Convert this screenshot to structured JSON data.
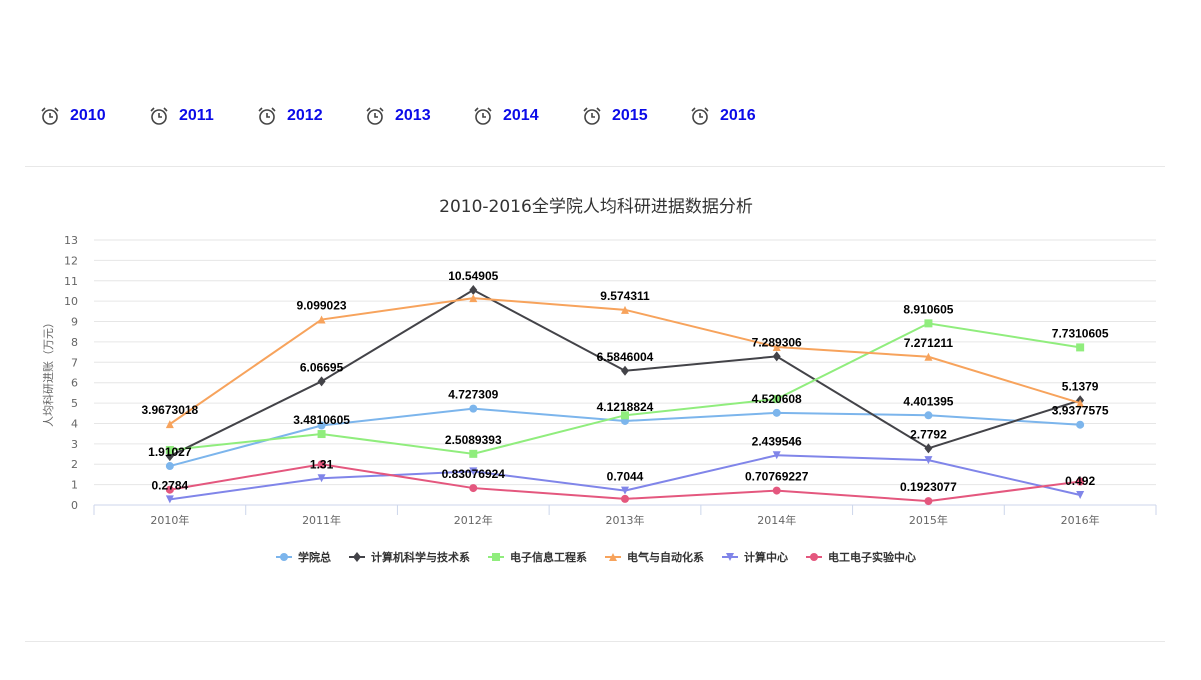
{
  "year_tabs": [
    "2010",
    "2011",
    "2012",
    "2013",
    "2014",
    "2015",
    "2016"
  ],
  "chart_data": {
    "type": "line",
    "title": "2010-2016全学院人均科研进据数据分析",
    "ylabel": "人均科研进账（万元）",
    "xlabel": "",
    "ylim": [
      0,
      13
    ],
    "yticks": [
      0,
      1,
      2,
      3,
      4,
      5,
      6,
      7,
      8,
      9,
      10,
      11,
      12,
      13
    ],
    "grid": true,
    "legend_position": "bottom",
    "categories": [
      "2010年",
      "2011年",
      "2012年",
      "2013年",
      "2014年",
      "2015年",
      "2016年"
    ],
    "series": [
      {
        "name": "学院总",
        "color": "#7cb5ec",
        "marker": "circle",
        "values": [
          1.91027,
          3.9,
          4.727309,
          4.1218824,
          4.520608,
          4.401395,
          3.9377575
        ],
        "labels": [
          "1.91027",
          null,
          "4.727309",
          "4.1218824",
          "4.520608",
          "4.401395",
          "3.9377575"
        ]
      },
      {
        "name": "计算机科学与技术系",
        "color": "#434348",
        "marker": "diamond",
        "values": [
          2.4,
          6.06695,
          10.54905,
          6.5846004,
          7.289306,
          2.7792,
          5.1379
        ],
        "labels": [
          null,
          "6.06695",
          "10.54905",
          "6.5846004",
          "7.289306",
          "2.7792",
          "5.1379"
        ]
      },
      {
        "name": "电子信息工程系",
        "color": "#90ed7d",
        "marker": "square",
        "values": [
          2.7,
          3.4810605,
          2.5089393,
          4.4,
          5.2,
          8.910605,
          7.7310605
        ],
        "labels": [
          null,
          "3.4810605",
          "2.5089393",
          null,
          null,
          "8.910605",
          "7.7310605"
        ]
      },
      {
        "name": "电气与自动化系",
        "color": "#f7a35c",
        "marker": "triangle",
        "values": [
          3.9673018,
          9.099023,
          10.15,
          9.574311,
          7.75,
          7.271211,
          5.0
        ],
        "labels": [
          "3.9673018",
          "9.099023",
          null,
          "9.574311",
          null,
          "7.271211",
          null
        ]
      },
      {
        "name": "计算中心",
        "color": "#8085e9",
        "marker": "triangle-down",
        "values": [
          0.2784,
          1.31,
          1.65,
          0.7044,
          2.439546,
          2.2,
          0.492
        ],
        "labels": [
          "0.2784",
          "1.31",
          null,
          "0.7044",
          "2.439546",
          null,
          "0.492"
        ]
      },
      {
        "name": "电工电子实验中心",
        "color": "#e4577e",
        "marker": "circle",
        "values": [
          0.75,
          2.0,
          0.83076924,
          0.3,
          0.70769227,
          0.1923077,
          1.15
        ],
        "labels": [
          null,
          null,
          "0.83076924",
          null,
          "0.70769227",
          "0.1923077",
          null
        ]
      }
    ]
  }
}
